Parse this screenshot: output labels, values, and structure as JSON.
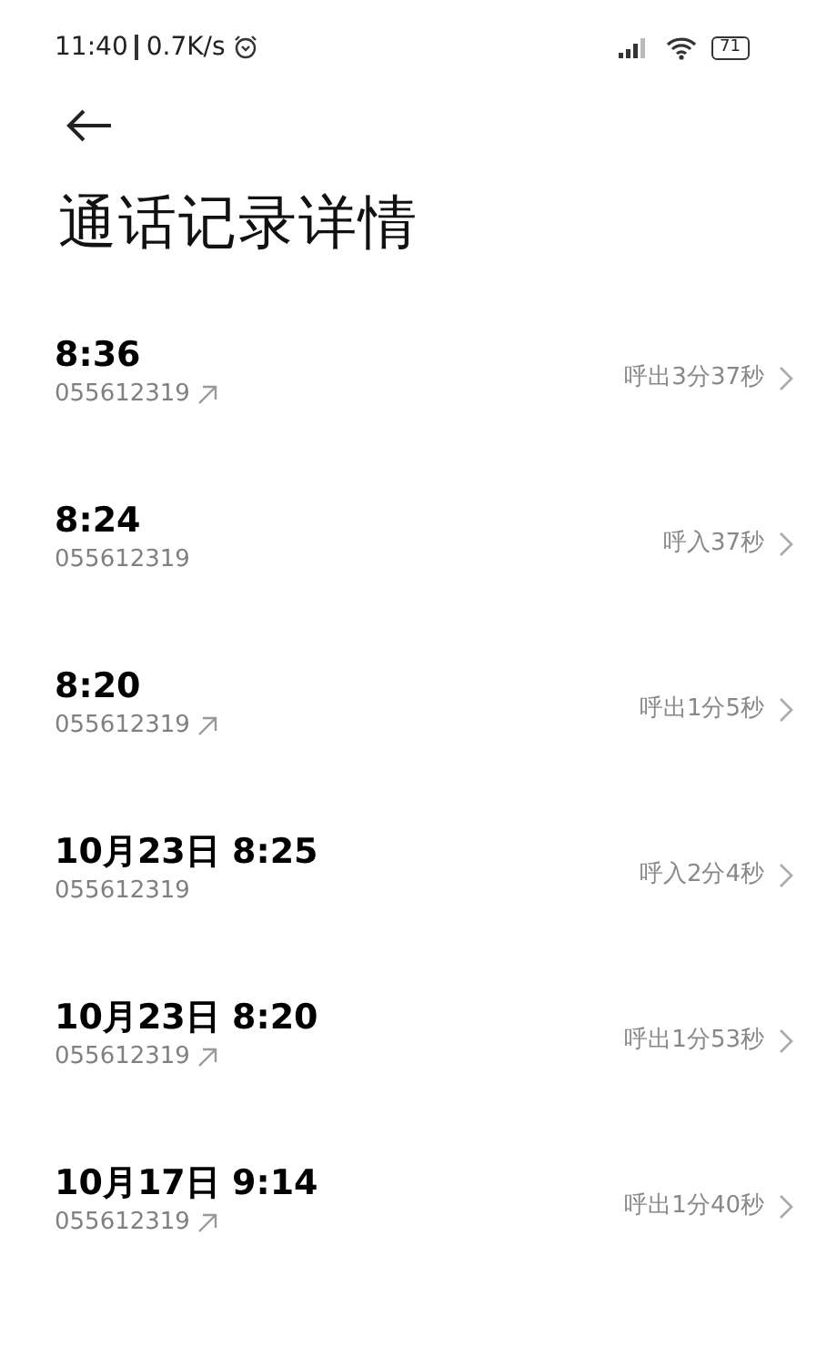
{
  "status_bar": {
    "time": "11:40",
    "speed": "0.7K/s",
    "battery": "71"
  },
  "title": "通话记录详情",
  "calls": [
    {
      "time": "8:36",
      "number": "055612319",
      "kind": "outgoing",
      "duration": "呼出3分37秒"
    },
    {
      "time": "8:24",
      "number": "055612319",
      "kind": "incoming",
      "duration": "呼入37秒"
    },
    {
      "time": "8:20",
      "number": "055612319",
      "kind": "outgoing",
      "duration": "呼出1分5秒"
    },
    {
      "time": "10月23日 8:25",
      "number": "055612319",
      "kind": "incoming",
      "duration": "呼入2分4秒"
    },
    {
      "time": "10月23日 8:20",
      "number": "055612319",
      "kind": "outgoing",
      "duration": "呼出1分53秒"
    },
    {
      "time": "10月17日 9:14",
      "number": "055612319",
      "kind": "outgoing",
      "duration": "呼出1分40秒"
    }
  ]
}
